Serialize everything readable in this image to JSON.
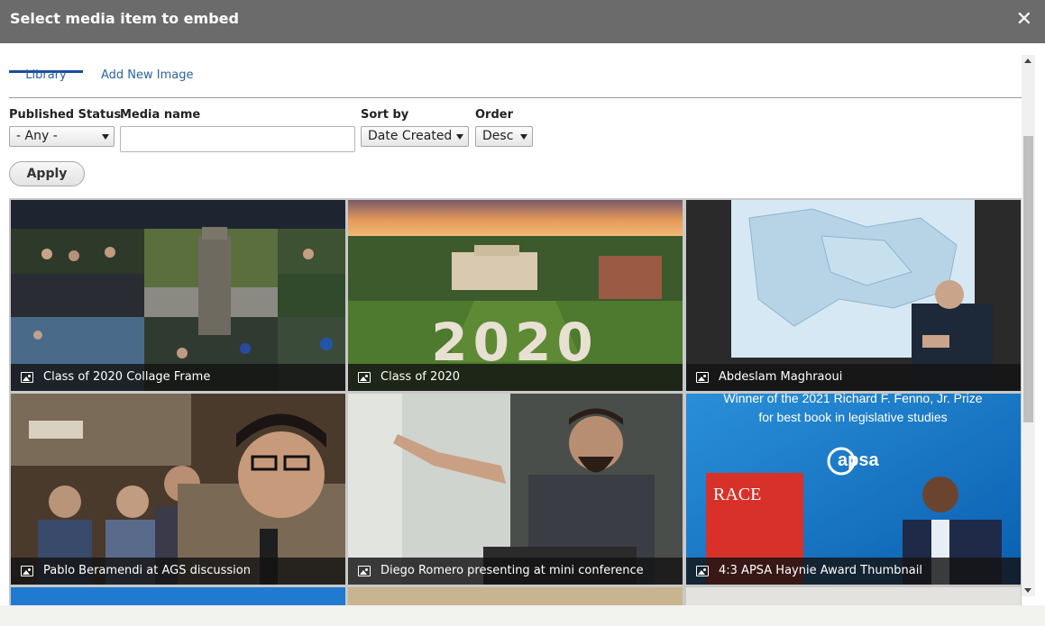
{
  "dialog": {
    "title": "Select media item to embed",
    "close_label": "✕"
  },
  "tabs": [
    {
      "label": "Library",
      "active": true
    },
    {
      "label": "Add New Image",
      "active": false
    }
  ],
  "filters": {
    "published_status": {
      "label": "Published Status",
      "value": "- Any -"
    },
    "media_name": {
      "label": "Media name",
      "value": ""
    },
    "sort_by": {
      "label": "Sort by",
      "value": "Date Created"
    },
    "order": {
      "label": "Order",
      "value": "Desc"
    },
    "apply_label": "Apply"
  },
  "media_items": [
    {
      "name": "Class of 2020 Collage Frame",
      "icon": "image-icon"
    },
    {
      "name": "Class of 2020",
      "icon": "image-icon"
    },
    {
      "name": "Abdeslam Maghraoui",
      "icon": "image-icon"
    },
    {
      "name": "Pablo Beramendi at AGS discussion",
      "icon": "image-icon"
    },
    {
      "name": "Diego Romero presenting at mini conference",
      "icon": "image-icon"
    },
    {
      "name": "4:3 APSA Haynie Award Thumbnail",
      "icon": "image-icon"
    }
  ],
  "thumbnail_texts": {
    "award_line1": "Winner of the 2021 Richard F. Fenno, Jr. Prize",
    "award_line2": "for best book in legislative studies",
    "apsa_logo": "apsa",
    "book_title": "RACE",
    "grad_year": "2020"
  },
  "colors": {
    "titlebar": "#6b6b6b",
    "tab_active": "#1a4aa0",
    "link": "#2a62a8"
  }
}
